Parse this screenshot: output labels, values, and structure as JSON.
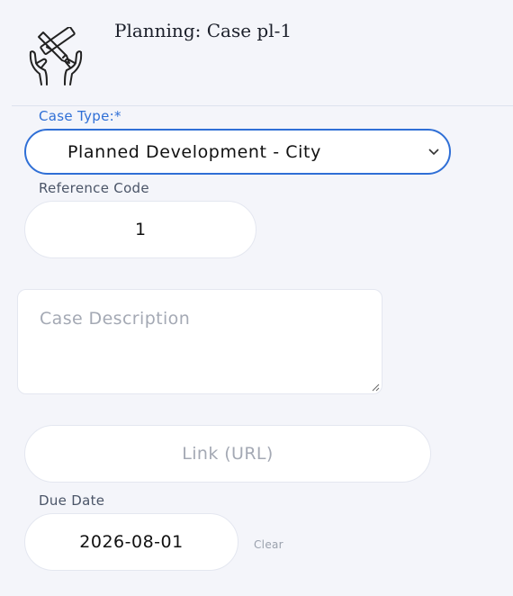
{
  "header": {
    "title": "Planning: Case pl-1",
    "logo_icon": "hands-with-tools-icon"
  },
  "form": {
    "case_type": {
      "label": "Case Type:*",
      "value": "Planned Development - City"
    },
    "reference_code": {
      "label": "Reference Code",
      "value": "1"
    },
    "description": {
      "placeholder": "Case Description",
      "value": ""
    },
    "link": {
      "placeholder": "Link (URL)",
      "value": ""
    },
    "due_date": {
      "label": "Due Date",
      "value": "2026-08-01",
      "clear_label": "Clear"
    }
  },
  "colors": {
    "accent": "#2f6fd6",
    "background": "#f4f5fa",
    "field_background": "#ffffff",
    "placeholder": "#a4a9b4"
  }
}
